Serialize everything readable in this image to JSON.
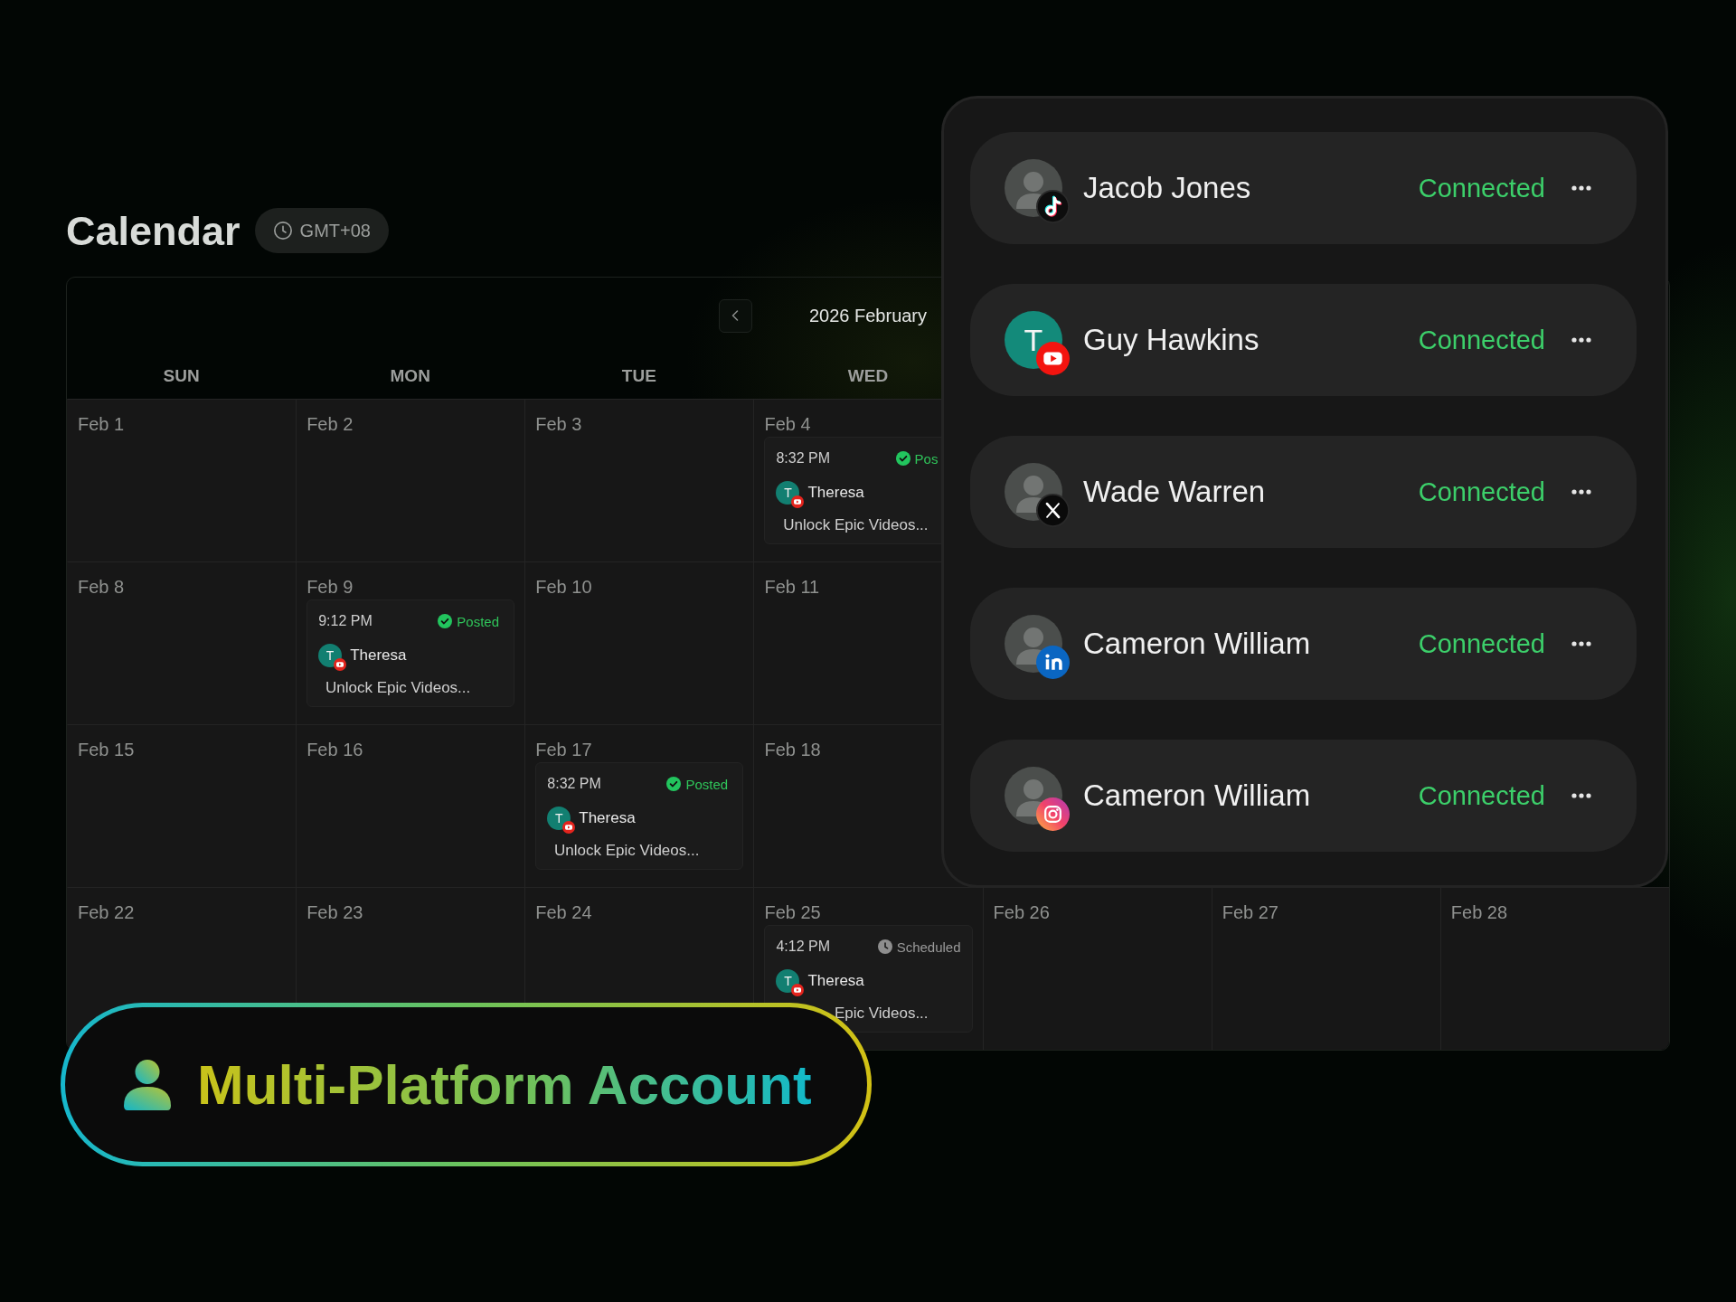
{
  "header": {
    "title": "Calendar",
    "timezone": "GMT+08"
  },
  "calendar": {
    "month": "2026 February",
    "weekdays": [
      "SUN",
      "MON",
      "TUE",
      "WED"
    ],
    "weeks": [
      {
        "days": [
          {
            "date": "Feb 1"
          },
          {
            "date": "Feb 2"
          },
          {
            "date": "Feb 3"
          },
          {
            "date": "Feb 4",
            "events": [
              {
                "time": "8:32 PM",
                "status": {
                  "kind": "posted",
                  "label": "Pos"
                },
                "initial": "T",
                "author": "Theresa",
                "title": "Unlock Epic Videos..."
              }
            ]
          }
        ]
      },
      {
        "days": [
          {
            "date": "Feb 8"
          },
          {
            "date": "Feb 9",
            "events": [
              {
                "time": "9:12 PM",
                "status": {
                  "kind": "posted",
                  "label": "Posted"
                },
                "initial": "T",
                "author": "Theresa",
                "title": "Unlock Epic Videos..."
              }
            ]
          },
          {
            "date": "Feb 10"
          },
          {
            "date": "Feb 11"
          }
        ]
      },
      {
        "days": [
          {
            "date": "Feb 15"
          },
          {
            "date": "Feb 16"
          },
          {
            "date": "Feb 17",
            "events": [
              {
                "time": "8:32 PM",
                "status": {
                  "kind": "posted",
                  "label": "Posted"
                },
                "initial": "T",
                "author": "Theresa",
                "title": "Unlock Epic Videos..."
              }
            ]
          },
          {
            "date": "Feb 18"
          }
        ]
      },
      {
        "days": [
          {
            "date": "Feb 22"
          },
          {
            "date": "Feb 23"
          },
          {
            "date": "Feb 24"
          },
          {
            "date": "Feb 25",
            "events": [
              {
                "time": "4:12 PM",
                "status": {
                  "kind": "scheduled",
                  "label": "Scheduled"
                },
                "initial": "T",
                "author": "Theresa",
                "title": "Epic Videos..."
              }
            ]
          },
          {
            "date": "Feb 26"
          },
          {
            "date": "Feb 27"
          },
          {
            "date": "Feb 28"
          }
        ]
      }
    ]
  },
  "accounts_panel": {
    "accounts": [
      {
        "kind": "tiktok",
        "avatar": {
          "kind": "photo"
        },
        "name": "Jacob Jones",
        "status": "Connected"
      },
      {
        "kind": "youtube",
        "avatar": {
          "kind": "initial",
          "initial": "T"
        },
        "name": "Guy Hawkins",
        "status": "Connected"
      },
      {
        "kind": "x",
        "avatar": {
          "kind": "photo"
        },
        "name": "Wade Warren",
        "status": "Connected"
      },
      {
        "kind": "linkedin",
        "avatar": {
          "kind": "photo"
        },
        "name": "Cameron William",
        "status": "Connected"
      },
      {
        "kind": "instagram",
        "avatar": {
          "kind": "photo"
        },
        "name": "Cameron William",
        "status": "Connected"
      }
    ]
  },
  "feature_badge": {
    "title": "Multi-Platform Account"
  }
}
